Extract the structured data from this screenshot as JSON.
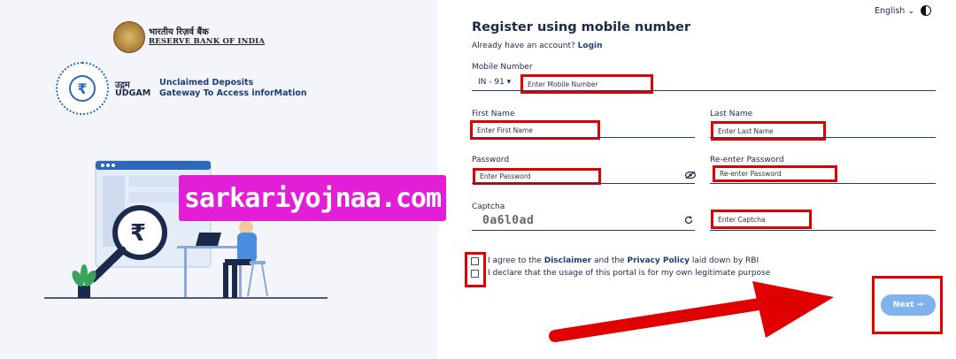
{
  "header": {
    "rbi_hindi": "भारतीय रिज़र्व बैंक",
    "rbi_english": "RESERVE BANK OF INDIA",
    "udgam_hindi": "उद्गम",
    "udgam_english": "UDGAM",
    "udgam_desc_line1": "Unclaimed Deposits",
    "udgam_desc_line2": "Gateway To Access inforMation",
    "language": "English ⌄"
  },
  "watermark": "sarkariyojnaa.com",
  "form": {
    "title": "Register using mobile number",
    "have_account": "Already have an account?",
    "login_link": "Login",
    "mobile_label": "Mobile Number",
    "country_code": "IN - 91 ▾",
    "mobile_placeholder": "Enter Mobile Number",
    "first_name_label": "First Name",
    "first_name_placeholder": "Enter First Name",
    "last_name_label": "Last Name",
    "last_name_placeholder": "Enter Last Name",
    "password_label": "Password",
    "password_placeholder": "Enter Password",
    "reenter_password_label": "Re-enter Password",
    "reenter_password_placeholder": "Re-enter Password",
    "captcha_label": "Captcha",
    "captcha_value": "0a6l0ad",
    "captcha_placeholder": "Enter Captcha",
    "agree_prefix": "I agree to the",
    "disclaimer_link": "Disclaimer",
    "agree_and": "and the",
    "privacy_link": "Privacy Policy",
    "agree_suffix": "laid down by RBI",
    "declare_text": "I declare that the usage of this portal is for my own legitimate purpose",
    "next_button": "Next →"
  },
  "colors": {
    "accent": "#1b3d78",
    "highlight": "#e00000",
    "watermark_bg": "#e21ed6",
    "next_button": "#7fb2ef"
  },
  "icons": [
    "rbi-emblem-icon",
    "rupee-icon",
    "moon-icon",
    "eye-off-icon",
    "refresh-icon",
    "arrow-right-icon"
  ]
}
